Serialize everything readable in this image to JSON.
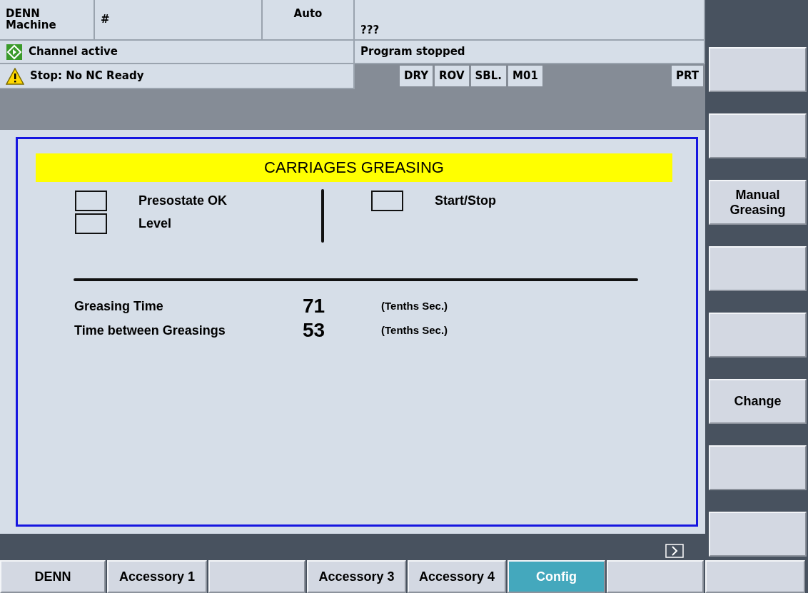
{
  "header": {
    "machine": "DENN\nMachine",
    "program_marker": "#",
    "mode": "Auto",
    "program_name": "???",
    "channel_status": "Channel active",
    "program_status": "Program stopped",
    "alarm": "Stop: No NC Ready",
    "flags": [
      "DRY",
      "ROV",
      "SBL.",
      "M01"
    ],
    "right_flags": [
      "PRT"
    ]
  },
  "panel": {
    "title": "CARRIAGES GREASING",
    "left_indicators": [
      {
        "label": "Presostate OK",
        "checked": false
      },
      {
        "label": "Level",
        "checked": false
      }
    ],
    "right_indicators": [
      {
        "label": "Start/Stop",
        "checked": false
      }
    ],
    "parameters": [
      {
        "label": "Greasing Time",
        "value": "71",
        "unit": "(Tenths Sec.)"
      },
      {
        "label": "Time between Greasings",
        "value": "53",
        "unit": "(Tenths Sec.)"
      }
    ]
  },
  "vertical_softkeys": [
    {
      "kind": "blank"
    },
    {
      "kind": "blank"
    },
    {
      "kind": "labeled",
      "label": "Manual\nGreasing"
    },
    {
      "kind": "blank"
    },
    {
      "kind": "blank"
    },
    {
      "kind": "labeled",
      "label": "Change"
    },
    {
      "kind": "blank"
    },
    {
      "kind": "blank"
    }
  ],
  "horizontal_softkeys": [
    {
      "kind": "labeled",
      "label": "DENN",
      "selected": false
    },
    {
      "kind": "labeled",
      "label": "Accessory 1",
      "selected": false
    },
    {
      "kind": "blank",
      "selected": false
    },
    {
      "kind": "labeled",
      "label": "Accessory 3",
      "selected": false
    },
    {
      "kind": "labeled",
      "label": "Accessory 4",
      "selected": false
    },
    {
      "kind": "labeled",
      "label": "Config",
      "selected": true
    },
    {
      "kind": "blank",
      "selected": false
    },
    {
      "kind": "blank",
      "selected": false
    }
  ]
}
